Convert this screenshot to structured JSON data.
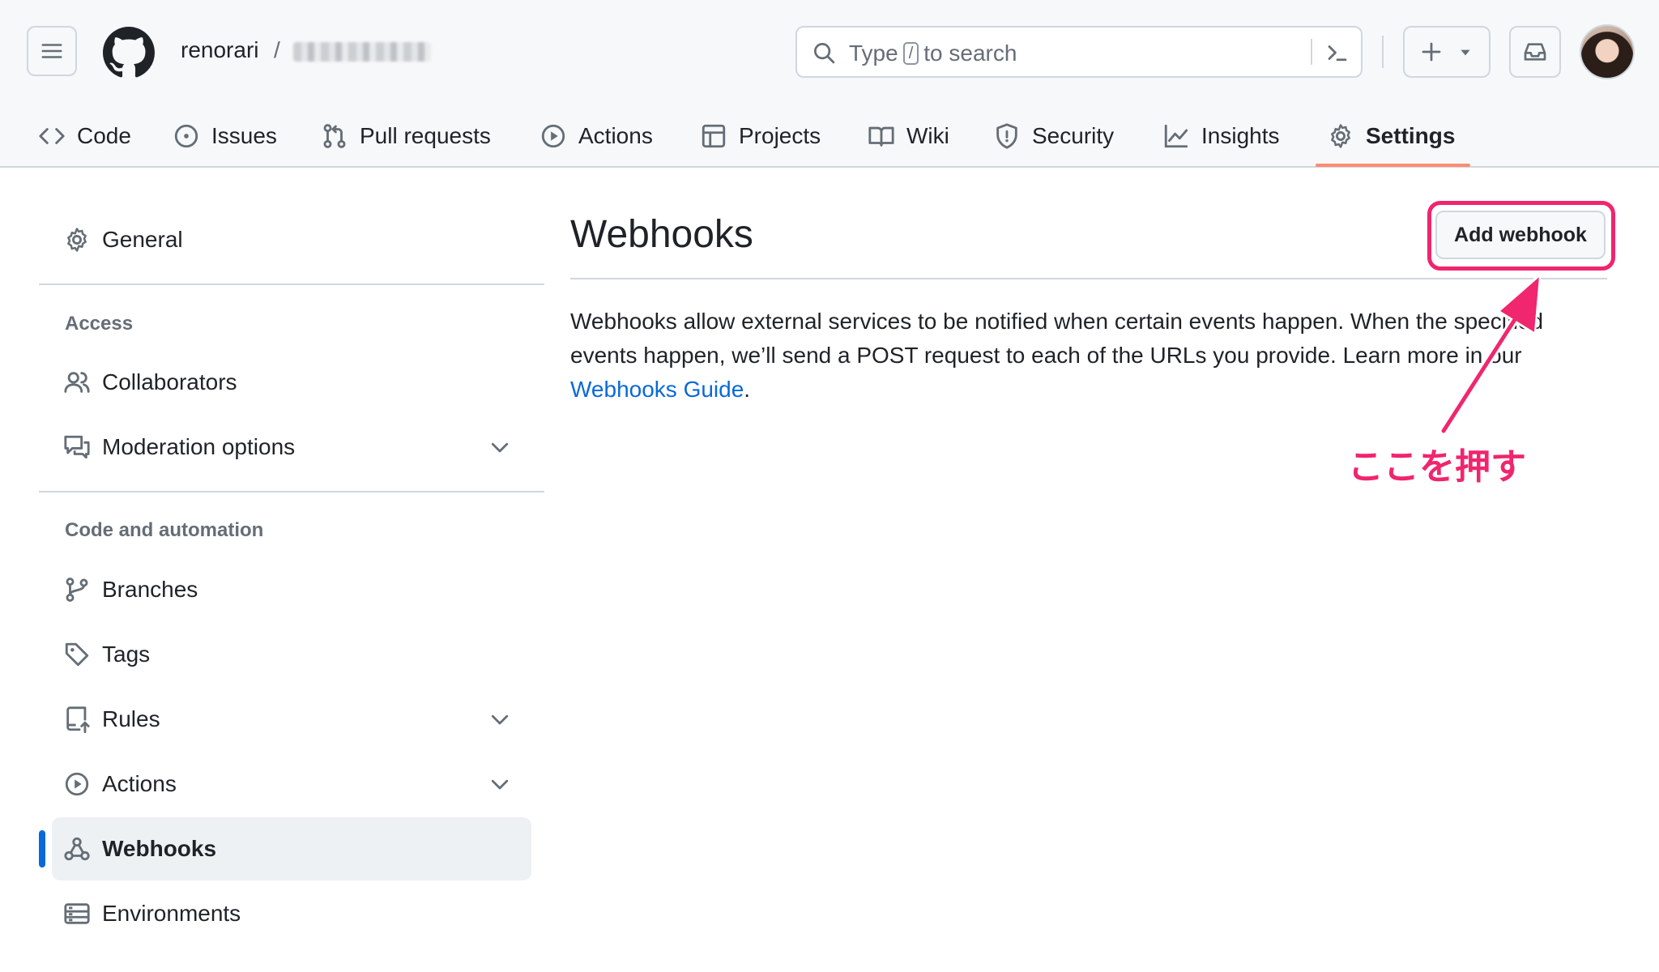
{
  "header": {
    "owner": "renorari",
    "slash": "/",
    "search": {
      "prefix": "Type",
      "key": "/",
      "suffix": "to search"
    }
  },
  "tabs": [
    {
      "label": "Code"
    },
    {
      "label": "Issues"
    },
    {
      "label": "Pull requests"
    },
    {
      "label": "Actions"
    },
    {
      "label": "Projects"
    },
    {
      "label": "Wiki"
    },
    {
      "label": "Security"
    },
    {
      "label": "Insights"
    },
    {
      "label": "Settings"
    }
  ],
  "sidebar": {
    "general": "General",
    "access_heading": "Access",
    "collaborators": "Collaborators",
    "moderation": "Moderation options",
    "code_heading": "Code and automation",
    "branches": "Branches",
    "tags": "Tags",
    "rules": "Rules",
    "actions": "Actions",
    "webhooks": "Webhooks",
    "environments": "Environments"
  },
  "main": {
    "title": "Webhooks",
    "add_button": "Add webhook",
    "description": "Webhooks allow external services to be notified when certain events happen. When the specified events happen, we’ll send a POST request to each of the URLs you provide. Learn more in our",
    "guide_link": "Webhooks Guide",
    "period": "."
  },
  "annotation": {
    "text": "ここを押す",
    "color": "#f0256e"
  },
  "colors": {
    "accent": "#0969da",
    "active_tab": "#fd8c73",
    "highlight": "#f0256e"
  }
}
